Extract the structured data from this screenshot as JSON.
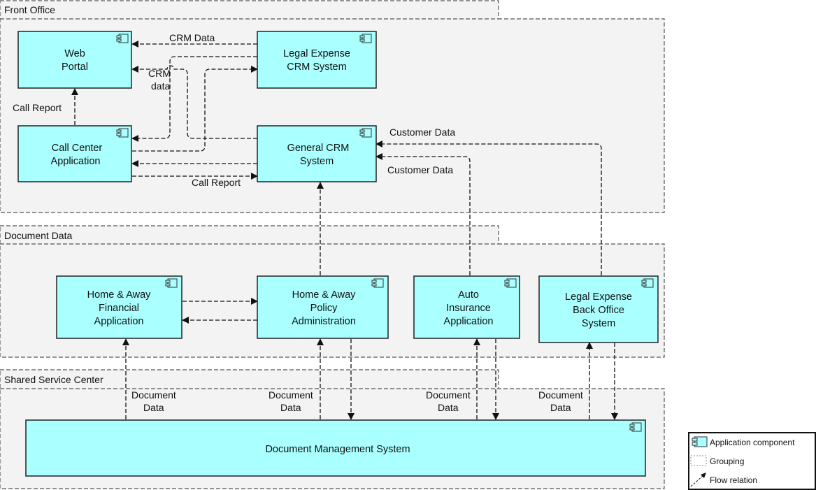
{
  "groups": [
    {
      "id": "front-office",
      "label": "Front Office"
    },
    {
      "id": "document-data",
      "label": "Document Data"
    },
    {
      "id": "shared-service-center",
      "label": "Shared Service Center"
    }
  ],
  "components": {
    "web_portal": [
      "Web",
      "Portal"
    ],
    "legal_crm": [
      "Legal Expense",
      "CRM System"
    ],
    "call_center": [
      "Call Center",
      "Application"
    ],
    "general_crm": [
      "General CRM",
      "System"
    ],
    "ha_financial": [
      "Home & Away",
      "Financial",
      "Application"
    ],
    "ha_policy": [
      "Home & Away",
      "Policy",
      "Administration"
    ],
    "auto_insurance": [
      "Auto",
      "Insurance",
      "Application"
    ],
    "legal_backoffice": [
      "Legal Expense",
      "Back Office",
      "System"
    ],
    "dms": [
      "Document Management System"
    ]
  },
  "flow_labels": {
    "crm_data": "CRM Data",
    "crm_data_lower": [
      "CRM",
      "data"
    ],
    "call_report_up": "Call Report",
    "call_report_right": "Call Report",
    "customer_data_top": "Customer Data",
    "customer_data_bottom": "Customer Data",
    "document_data": [
      "Document",
      "Data"
    ]
  },
  "legend": {
    "items": [
      {
        "icon": "application-component-icon",
        "label": "Application component"
      },
      {
        "icon": "grouping-icon",
        "label": "Grouping"
      },
      {
        "icon": "flow-relation-icon",
        "label": "Flow relation"
      }
    ]
  }
}
